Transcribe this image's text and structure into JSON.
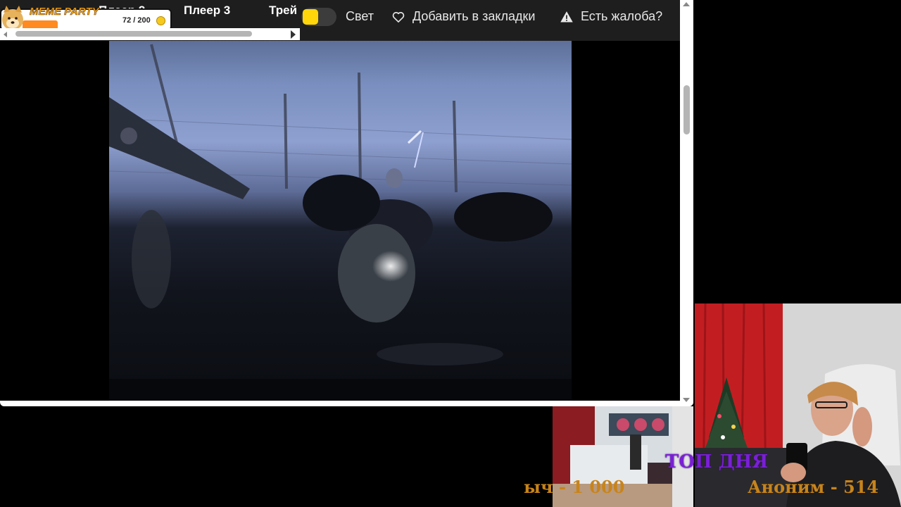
{
  "browser": {
    "tabs": [
      {
        "label": "Плеер 2"
      },
      {
        "label": "Плеер 3"
      },
      {
        "label": "Трей"
      }
    ],
    "toolbar": {
      "light_label": "Свет",
      "bookmark_label": "Добавить в закладки",
      "complaint_label": "Есть жалоба?"
    },
    "colors": {
      "toggle_knob": "#ffd60a",
      "topbar": "#1e1e1e"
    }
  },
  "meme_party": {
    "title": "MEME PARTY",
    "counter": "72 / 200",
    "progress": 0.36,
    "icons": [
      "doge-icon",
      "coin-icon"
    ]
  },
  "stream_overlay": {
    "top_label": "ТОП ДНЯ",
    "donors": [
      {
        "text": "ыч - 1 000"
      },
      {
        "text": "Аноним - 514"
      }
    ]
  }
}
